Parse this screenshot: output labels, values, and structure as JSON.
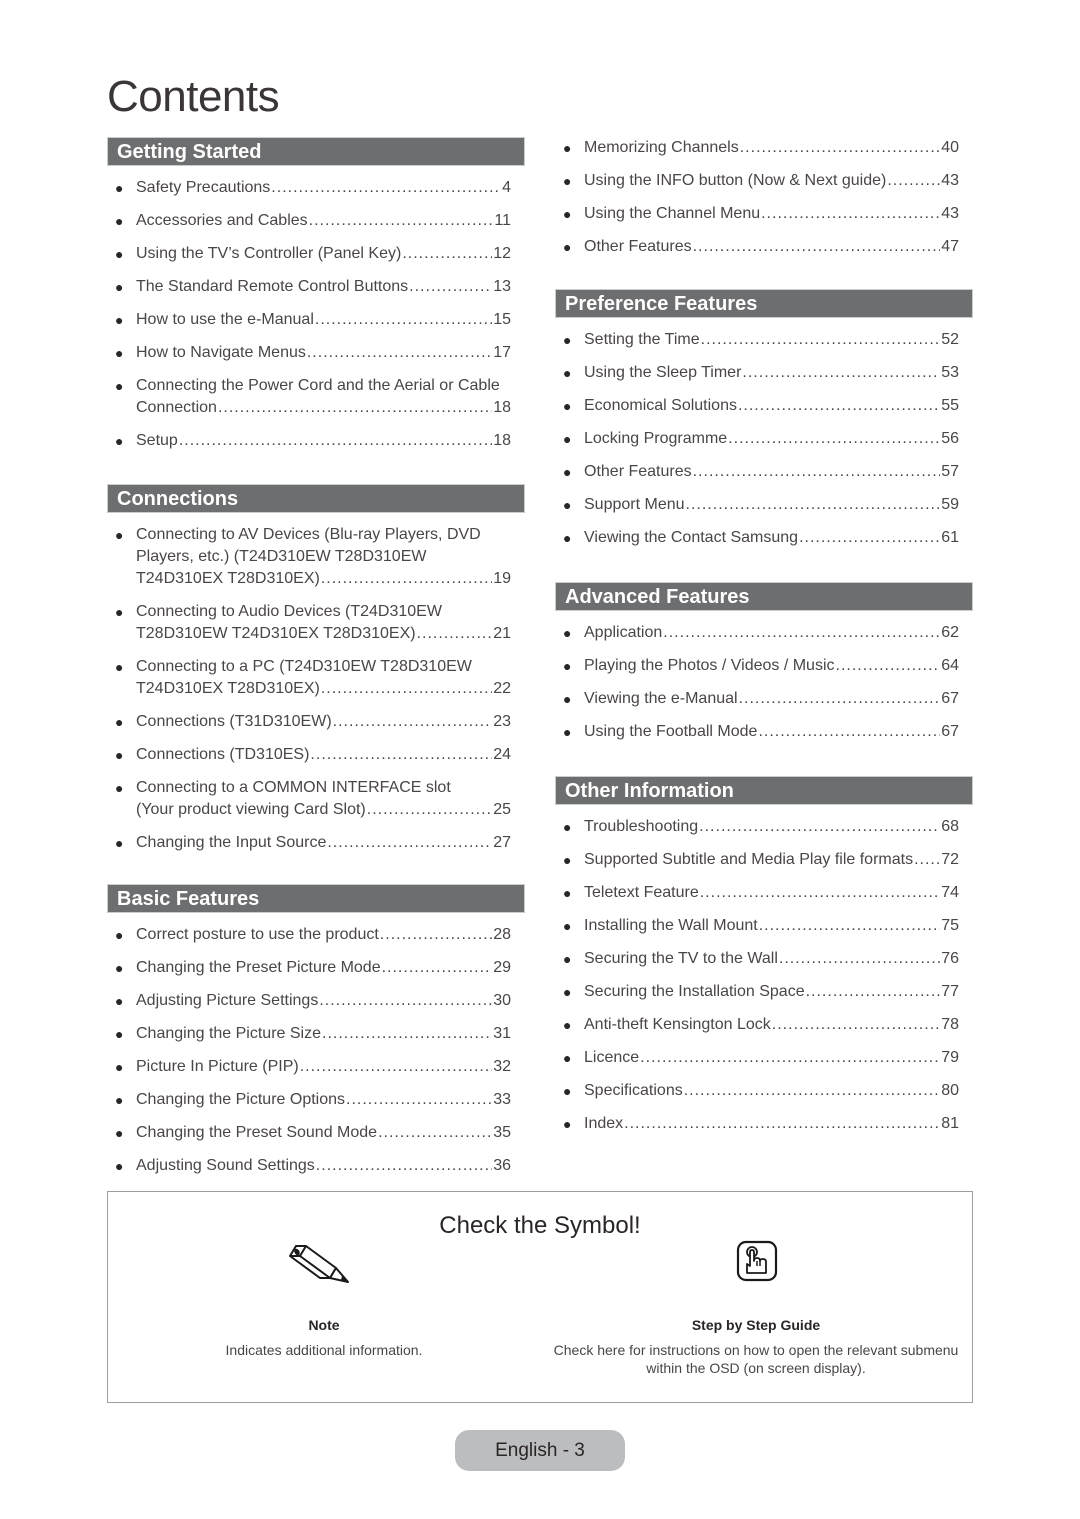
{
  "page_title": "Contents",
  "sections": {
    "getting_started": {
      "title": "Getting Started",
      "items": [
        {
          "label": "Safety Precautions",
          "page": "4"
        },
        {
          "label": "Accessories and Cables",
          "page": "11"
        },
        {
          "label": "Using the TV’s Controller (Panel Key)",
          "page": "12"
        },
        {
          "label": "The Standard Remote Control Buttons",
          "page": "13"
        },
        {
          "label": "How to use the e-Manual",
          "page": "15"
        },
        {
          "label": "How to Navigate Menus",
          "page": "17"
        },
        {
          "pre": "Connecting the Power Cord and the Aerial or Cable",
          "label": "Connection",
          "page": "18"
        },
        {
          "label": "Setup",
          "page": "18"
        }
      ]
    },
    "connections": {
      "title": "Connections",
      "items": [
        {
          "pre": "Connecting to AV Devices (Blu-ray Players, DVD",
          "pre2": "Players, etc.) (T24D310EW T28D310EW",
          "label": "T24D310EX T28D310EX)",
          "page": "19"
        },
        {
          "pre": "Connecting to Audio Devices (T24D310EW",
          "label": "T28D310EW T24D310EX T28D310EX)",
          "page": "21"
        },
        {
          "pre": "Connecting to a PC (T24D310EW T28D310EW",
          "label": "T24D310EX T28D310EX)",
          "page": "22"
        },
        {
          "label": "Connections (T31D310EW)",
          "page": "23"
        },
        {
          "label": "Connections (TD310ES)",
          "page": "24"
        },
        {
          "pre": "Connecting to a COMMON INTERFACE slot",
          "label": "(Your product viewing Card Slot)",
          "page": "25"
        },
        {
          "label": "Changing the Input Source",
          "page": "27"
        }
      ]
    },
    "basic_features": {
      "title": "Basic Features",
      "items": [
        {
          "label": "Correct posture to use the product",
          "page": "28"
        },
        {
          "label": "Changing the Preset Picture Mode",
          "page": "29"
        },
        {
          "label": "Adjusting Picture Settings",
          "page": "30"
        },
        {
          "label": "Changing the Picture Size",
          "page": "31"
        },
        {
          "label": "Picture In Picture (PIP)",
          "page": "32"
        },
        {
          "label": "Changing the Picture Options",
          "page": "33"
        },
        {
          "label": "Changing the Preset Sound Mode",
          "page": "35"
        },
        {
          "label": "Adjusting Sound Settings",
          "page": "36"
        }
      ]
    },
    "basic_continued": {
      "items": [
        {
          "label": "Memorizing Channels",
          "page": "40"
        },
        {
          "label": "Using the INFO button (Now & Next guide)",
          "page": "43"
        },
        {
          "label": "Using the Channel Menu",
          "page": "43"
        },
        {
          "label": "Other Features",
          "page": "47"
        }
      ]
    },
    "preference_features": {
      "title": "Preference Features",
      "items": [
        {
          "label": "Setting the Time",
          "page": "52"
        },
        {
          "label": "Using the Sleep Timer",
          "page": "53"
        },
        {
          "label": "Economical Solutions",
          "page": "55"
        },
        {
          "label": "Locking Programme",
          "page": "56"
        },
        {
          "label": "Other Features",
          "page": "57"
        },
        {
          "label": "Support Menu",
          "page": "59"
        },
        {
          "label": "Viewing the Contact Samsung",
          "page": "61"
        }
      ]
    },
    "advanced_features": {
      "title": "Advanced Features",
      "items": [
        {
          "label": "Application",
          "page": "62"
        },
        {
          "label": "Playing the Photos / Videos / Music",
          "page": "64"
        },
        {
          "label": "Viewing the e-Manual",
          "page": "67"
        },
        {
          "label": "Using the Football Mode",
          "page": "67"
        }
      ]
    },
    "other_information": {
      "title": "Other Information",
      "items": [
        {
          "label": "Troubleshooting",
          "page": "68"
        },
        {
          "label": "Supported Subtitle and Media Play file formats",
          "page": "72"
        },
        {
          "label": "Teletext Feature",
          "page": "74"
        },
        {
          "label": "Installing the Wall Mount",
          "page": "75"
        },
        {
          "label": "Securing the TV to the Wall",
          "page": "76"
        },
        {
          "label": "Securing the Installation Space",
          "page": "77"
        },
        {
          "label": "Anti-theft Kensington Lock",
          "page": "78"
        },
        {
          "label": "Licence",
          "page": "79"
        },
        {
          "label": "Specifications",
          "page": "80"
        },
        {
          "label": "Index",
          "page": "81"
        }
      ]
    }
  },
  "symbol_box": {
    "title": "Check the Symbol!",
    "note": {
      "icon": "pencil-icon",
      "name": "Note",
      "description": "Indicates additional information."
    },
    "guide": {
      "icon": "hand-pointer-icon",
      "name": "Step by Step Guide",
      "description_line1": "Check here for instructions on how to open the relevant submenu",
      "description_line2": "within the OSD (on screen display)."
    }
  },
  "footer": {
    "page_label": "English - 3"
  },
  "colors": {
    "section_header_bg": "#6d6e70",
    "footer_pill_bg": "#bcbdbf",
    "text": "#4a4546"
  }
}
